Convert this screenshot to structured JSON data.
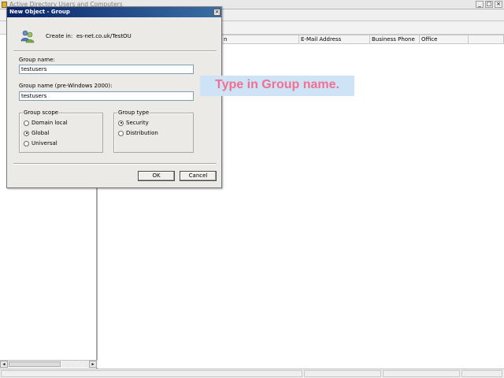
{
  "app": {
    "title": "Active Directory Users and Computers",
    "window_buttons": [
      "_",
      "□",
      "×"
    ]
  },
  "list_columns": [
    {
      "label": "n"
    },
    {
      "label": "E-Mail Address"
    },
    {
      "label": "Business Phone"
    },
    {
      "label": "Office"
    }
  ],
  "dialog": {
    "title": "New Object - Group",
    "close_glyph": "×",
    "create_in_label": "Create in:",
    "create_in_value": "es-net.co.uk/TestOU",
    "group_name_label": "Group name:",
    "group_name_value": "testusers",
    "group_name_pre2000_label": "Group name (pre-Windows 2000):",
    "group_name_pre2000_value": "testusers",
    "group_scope": {
      "legend": "Group scope",
      "options": [
        {
          "label": "Domain local",
          "checked": false
        },
        {
          "label": "Global",
          "checked": true
        },
        {
          "label": "Universal",
          "checked": false
        }
      ]
    },
    "group_type": {
      "legend": "Group type",
      "options": [
        {
          "label": "Security",
          "checked": true
        },
        {
          "label": "Distribution",
          "checked": false
        }
      ]
    },
    "ok_label": "OK",
    "cancel_label": "Cancel"
  },
  "callout": {
    "text": "Type in Group name."
  },
  "icons": {
    "dialog_icon": "users-group-icon",
    "app_icon": "ad-users-computers-icon"
  },
  "colors": {
    "dialog_titlebar": "#0a246a",
    "callout_background": "#cfe3f6",
    "callout_text": "#f07090"
  }
}
